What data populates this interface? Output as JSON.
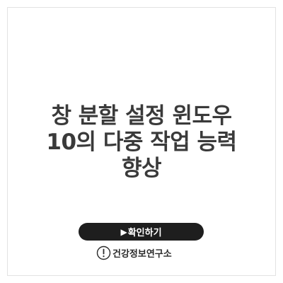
{
  "title": {
    "lines": [
      "창 분할 설정 윈도우",
      "10의 다중 작업 능력",
      "향상"
    ]
  },
  "button": {
    "icon": "play-icon",
    "label": "확인하기"
  },
  "source": {
    "icon": "exclamation-circle-icon",
    "label": "건강정보연구소"
  },
  "colors": {
    "background": "#ffffff",
    "title_text": "#3a3a3a",
    "button_bg": "#1e1e1e",
    "button_text": "#ffffff",
    "border": "#e3e3e3"
  }
}
